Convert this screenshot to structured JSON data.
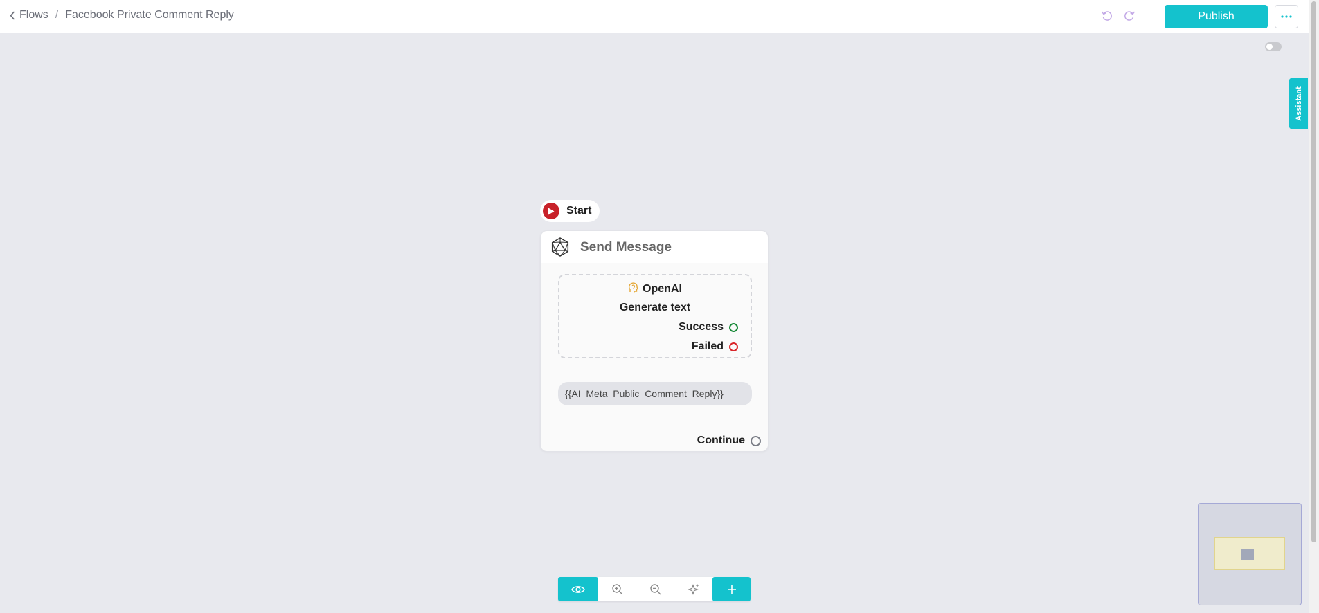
{
  "header": {
    "back_label": "Flows",
    "separator": "/",
    "flow_title": "Facebook Private Comment Reply",
    "publish_label": "Publish"
  },
  "sidebar_tab": {
    "assistant_label": "Assistant"
  },
  "canvas": {
    "start_label": "Start",
    "node": {
      "title": "Send Message",
      "integration": {
        "provider": "OpenAI",
        "action": "Generate text",
        "success_label": "Success",
        "failed_label": "Failed"
      },
      "variable": "{{AI_Meta_Public_Comment_Reply}}",
      "continue_label": "Continue"
    }
  },
  "colors": {
    "accent": "#14c2cd",
    "start_red": "#c8222a",
    "success_green": "#1a8a3a",
    "failed_red": "#d9262a",
    "canvas_bg": "#e8e9ee"
  },
  "icons": {
    "back": "chevron-left-icon",
    "undo": "undo-icon",
    "redo": "redo-icon",
    "more": "more-horizontal-icon",
    "start": "play-circle-icon",
    "node": "icosahedron-icon",
    "integration": "openai-brain-icon",
    "preview": "eye-icon",
    "zoom_in": "zoom-in-icon",
    "zoom_out": "zoom-out-icon",
    "auto_layout": "sparkle-icon",
    "add": "plus-icon"
  }
}
